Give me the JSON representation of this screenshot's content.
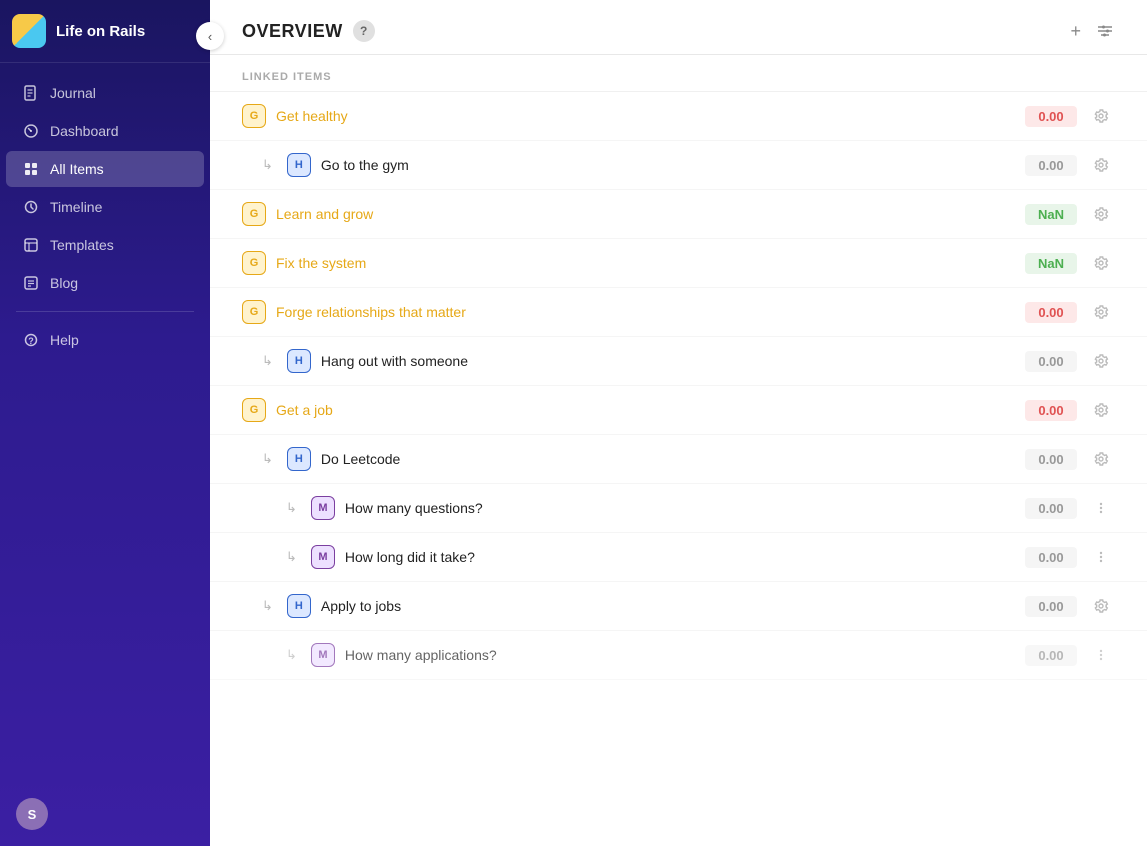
{
  "app": {
    "title": "Life on Rails",
    "logo_alt": "Life on Rails logo"
  },
  "sidebar": {
    "nav_items": [
      {
        "id": "journal",
        "label": "Journal",
        "active": false,
        "icon": "journal-icon"
      },
      {
        "id": "dashboard",
        "label": "Dashboard",
        "active": false,
        "icon": "dashboard-icon"
      },
      {
        "id": "all-items",
        "label": "All Items",
        "active": true,
        "icon": "all-items-icon"
      },
      {
        "id": "timeline",
        "label": "Timeline",
        "active": false,
        "icon": "timeline-icon"
      },
      {
        "id": "templates",
        "label": "Templates",
        "active": false,
        "icon": "templates-icon"
      },
      {
        "id": "blog",
        "label": "Blog",
        "active": false,
        "icon": "blog-icon"
      },
      {
        "id": "help",
        "label": "Help",
        "active": false,
        "icon": "help-icon"
      }
    ],
    "user_initial": "S"
  },
  "header": {
    "title": "OVERVIEW",
    "help_label": "?",
    "add_label": "+",
    "filter_label": "⊟"
  },
  "linked_items": {
    "section_label": "LINKED ITEMS",
    "items": [
      {
        "id": "get-healthy",
        "badge": "G",
        "badge_type": "g",
        "name": "Get healthy",
        "is_goal": true,
        "value": "0.00",
        "value_type": "red",
        "action": "gear",
        "indent": 0,
        "children": [
          {
            "id": "go-to-gym",
            "badge": "H",
            "badge_type": "h",
            "name": "Go to the gym",
            "is_goal": false,
            "value": "0.00",
            "value_type": "gray",
            "action": "gear",
            "indent": 1
          }
        ]
      },
      {
        "id": "learn-and-grow",
        "badge": "G",
        "badge_type": "g",
        "name": "Learn and grow",
        "is_goal": true,
        "value": "NaN",
        "value_type": "green",
        "action": "gear",
        "indent": 0
      },
      {
        "id": "fix-the-system",
        "badge": "G",
        "badge_type": "g",
        "name": "Fix the system",
        "is_goal": true,
        "value": "NaN",
        "value_type": "green",
        "action": "gear",
        "indent": 0
      },
      {
        "id": "forge-relationships",
        "badge": "G",
        "badge_type": "g",
        "name": "Forge relationships that matter",
        "is_goal": true,
        "value": "0.00",
        "value_type": "red",
        "action": "gear",
        "indent": 0,
        "children": [
          {
            "id": "hang-out",
            "badge": "H",
            "badge_type": "h",
            "name": "Hang out with someone",
            "is_goal": false,
            "value": "0.00",
            "value_type": "gray",
            "action": "gear",
            "indent": 1
          }
        ]
      },
      {
        "id": "get-a-job",
        "badge": "G",
        "badge_type": "g",
        "name": "Get a job",
        "is_goal": true,
        "value": "0.00",
        "value_type": "red",
        "action": "gear",
        "indent": 0,
        "children": [
          {
            "id": "do-leetcode",
            "badge": "H",
            "badge_type": "h",
            "name": "Do Leetcode",
            "is_goal": false,
            "value": "0.00",
            "value_type": "gray",
            "action": "gear",
            "indent": 1,
            "children": [
              {
                "id": "how-many-questions",
                "badge": "M",
                "badge_type": "m",
                "name": "How many questions?",
                "is_goal": false,
                "value": "0.00",
                "value_type": "gray",
                "action": "dots",
                "indent": 2
              },
              {
                "id": "how-long",
                "badge": "M",
                "badge_type": "m",
                "name": "How long did it take?",
                "is_goal": false,
                "value": "0.00",
                "value_type": "gray",
                "action": "dots",
                "indent": 2
              }
            ]
          },
          {
            "id": "apply-to-jobs",
            "badge": "H",
            "badge_type": "h",
            "name": "Apply to jobs",
            "is_goal": false,
            "value": "0.00",
            "value_type": "gray",
            "action": "gear",
            "indent": 1,
            "children": [
              {
                "id": "how-many-applications",
                "badge": "M",
                "badge_type": "m",
                "name": "How many applications?",
                "is_goal": false,
                "value": "0.00",
                "value_type": "gray",
                "action": "dots",
                "indent": 2
              }
            ]
          }
        ]
      }
    ]
  }
}
